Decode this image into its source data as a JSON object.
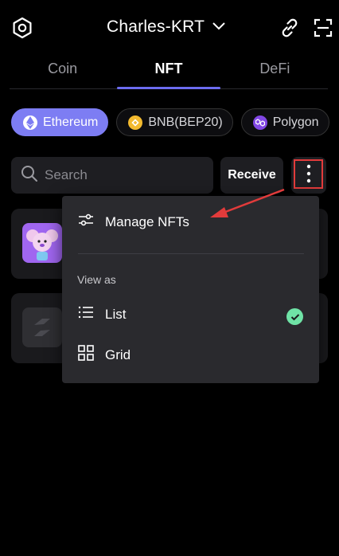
{
  "header": {
    "account_name": "Charles-KRT",
    "icons": [
      "settings-icon",
      "link-icon",
      "scan-icon",
      "chevron-down-icon"
    ]
  },
  "tabs": [
    {
      "label": "Coin",
      "active": false
    },
    {
      "label": "NFT",
      "active": true
    },
    {
      "label": "DeFi",
      "active": false
    }
  ],
  "chains": [
    {
      "label": "Ethereum",
      "active": true,
      "icon": "ethereum-icon",
      "color": "#ffffff"
    },
    {
      "label": "BNB(BEP20)",
      "active": false,
      "icon": "bnb-icon",
      "color": "#f3ba2f"
    },
    {
      "label": "Polygon",
      "active": false,
      "icon": "polygon-icon",
      "color": "#8247e5"
    }
  ],
  "search": {
    "placeholder": "Search"
  },
  "actions": {
    "receive_label": "Receive"
  },
  "menu": {
    "manage_label": "Manage NFTs",
    "view_as_label": "View as",
    "list_label": "List",
    "grid_label": "Grid",
    "selected_view": "List"
  },
  "colors": {
    "accent": "#7d7df3",
    "tab_underline": "#6c6cf0",
    "check": "#6fe3a6",
    "annotation_red": "#e23b3b"
  }
}
